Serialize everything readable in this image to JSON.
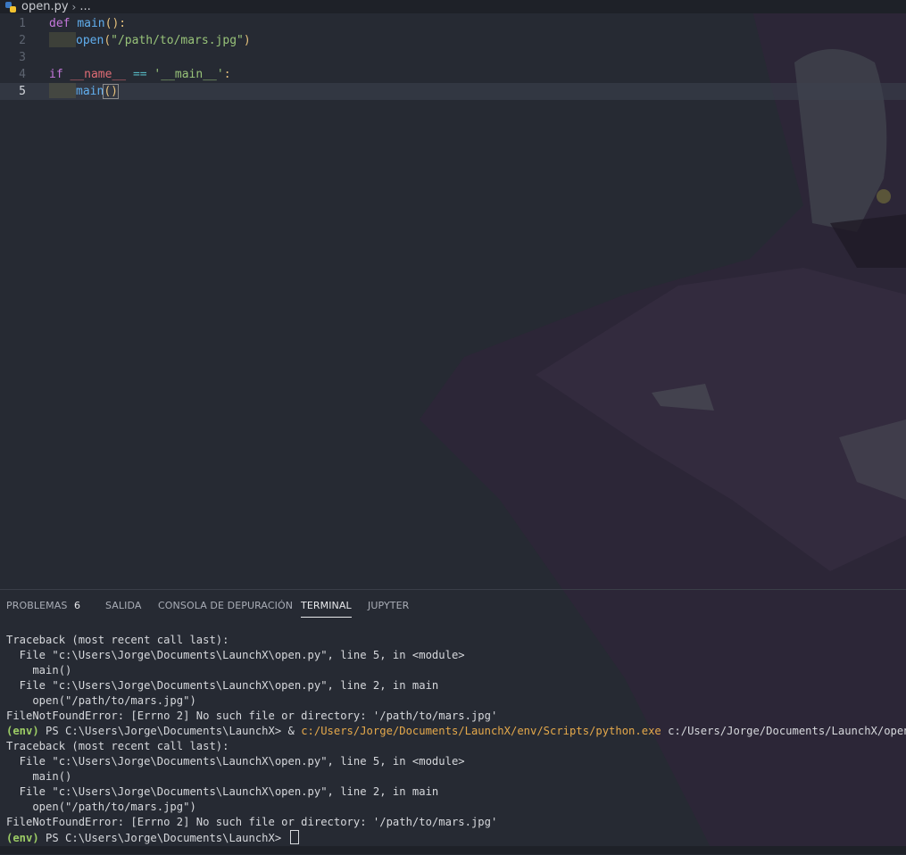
{
  "breadcrumb": {
    "file": "open.py",
    "more": "..."
  },
  "editor": {
    "lines": [
      {
        "number": "1",
        "tokens": [
          [
            "kw",
            "def"
          ],
          [
            "plain",
            " "
          ],
          [
            "fn",
            "main"
          ],
          [
            "punc",
            "():"
          ]
        ]
      },
      {
        "number": "2",
        "tokens": [
          [
            "fn",
            "open"
          ],
          [
            "punc",
            "("
          ],
          [
            "str",
            "\"/path/to/mars.jpg\""
          ],
          [
            "punc",
            ")"
          ]
        ]
      },
      {
        "number": "3",
        "tokens": []
      },
      {
        "number": "4",
        "tokens": [
          [
            "kw",
            "if"
          ],
          [
            "plain",
            " "
          ],
          [
            "dunder",
            "__name__"
          ],
          [
            "plain",
            " "
          ],
          [
            "op",
            "=="
          ],
          [
            "plain",
            " "
          ],
          [
            "str",
            "'__main__'"
          ],
          [
            "punc",
            ":"
          ]
        ]
      },
      {
        "number": "5",
        "tokens": [
          [
            "fn",
            "main"
          ],
          [
            "paren",
            "()"
          ]
        ]
      }
    ]
  },
  "panel": {
    "tabs": {
      "problems": "PROBLEMAS",
      "problems_count": "6",
      "output": "SALIDA",
      "debug_console": "CONSOLA DE DEPURACIÓN",
      "terminal": "TERMINAL",
      "jupyter": "JUPYTER"
    },
    "terminal_lines": [
      "Traceback (most recent call last):",
      "  File \"c:\\Users\\Jorge\\Documents\\LaunchX\\open.py\", line 5, in <module>",
      "    main()",
      "  File \"c:\\Users\\Jorge\\Documents\\LaunchX\\open.py\", line 2, in main",
      "    open(\"/path/to/mars.jpg\")",
      "FileNotFoundError: [Errno 2] No such file or directory: '/path/to/mars.jpg'",
      {
        "env": "(env)",
        "prompt": " PS C:\\Users\\Jorge\\Documents\\LaunchX> & ",
        "exe": "c:/Users/Jorge/Documents/LaunchX/env/Scripts/python.exe",
        "rest": " c:/Users/Jorge/Documents/LaunchX/open.py"
      },
      "Traceback (most recent call last):",
      "  File \"c:\\Users\\Jorge\\Documents\\LaunchX\\open.py\", line 5, in <module>",
      "    main()",
      "  File \"c:\\Users\\Jorge\\Documents\\LaunchX\\open.py\", line 2, in main",
      "    open(\"/path/to/mars.jpg\")",
      "FileNotFoundError: [Errno 2] No such file or directory: '/path/to/mars.jpg'",
      {
        "env": "(env)",
        "prompt": " PS C:\\Users\\Jorge\\Documents\\LaunchX> ",
        "cursor": true
      }
    ]
  }
}
